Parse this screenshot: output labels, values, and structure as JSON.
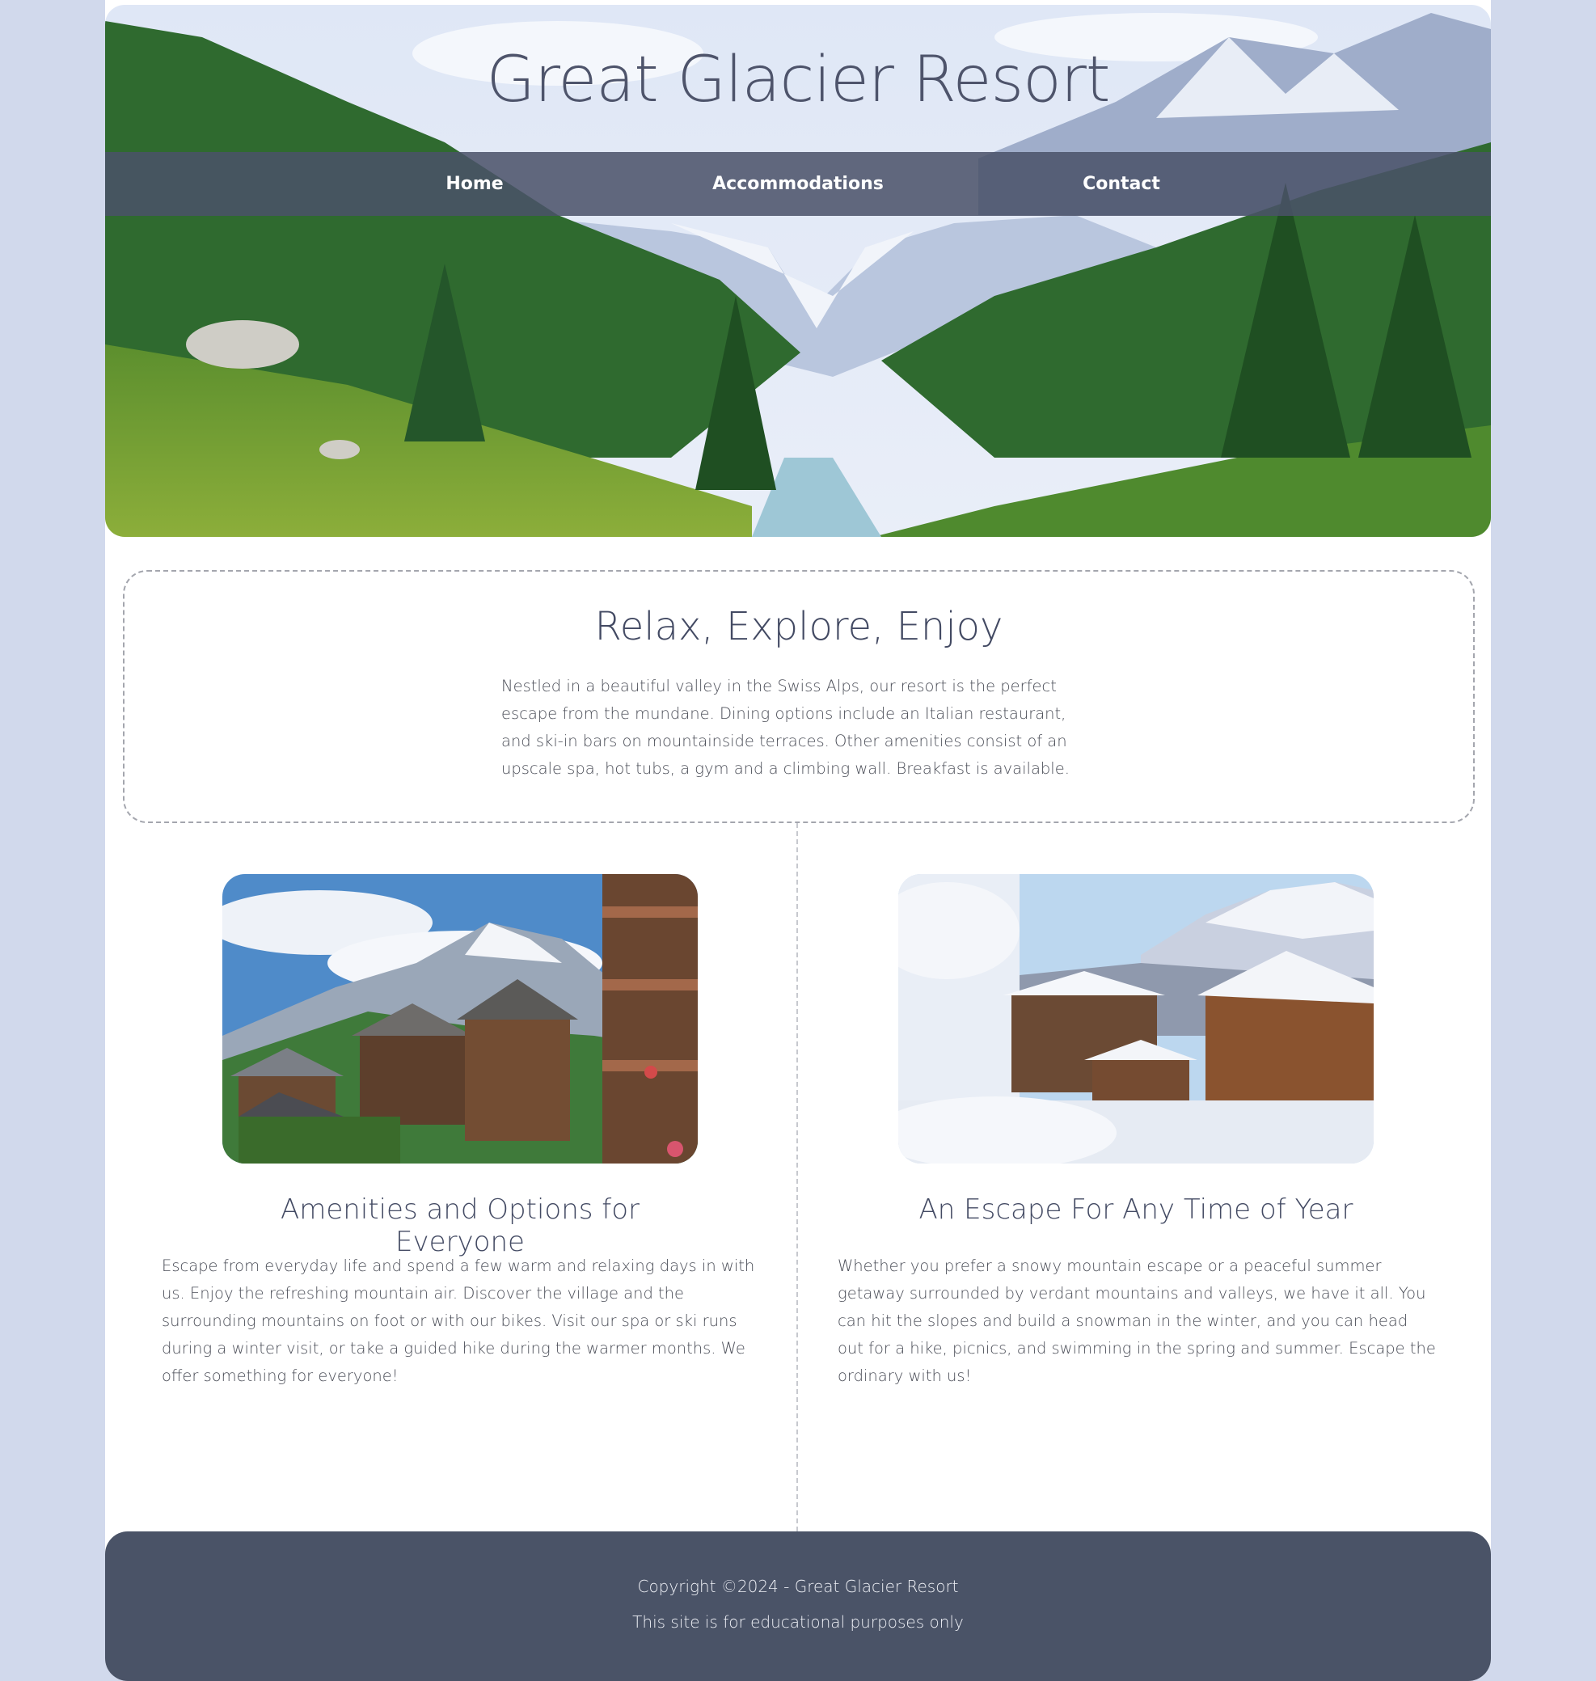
{
  "site": {
    "title": "Great Glacier Resort"
  },
  "nav": {
    "items": [
      {
        "label": "Home"
      },
      {
        "label": "Accommodations"
      },
      {
        "label": "Contact"
      }
    ]
  },
  "intro": {
    "heading": "Relax, Explore, Enjoy",
    "body": "Nestled in a beautiful valley in the Swiss Alps, our resort is the perfect escape from the mundane. Dining options include an Italian restaurant, and ski-in bars on mountainside terraces. Other amenities consist of an upscale spa, hot tubs, a gym and a climbing wall. Breakfast is available."
  },
  "features": [
    {
      "heading": "Amenities and Options for Everyone",
      "body": "Escape from everyday life and spend a few warm and relaxing days in with us. Enjoy the refreshing mountain air. Discover the village and the surrounding mountains on foot or with our bikes. Visit our spa or ski runs during a winter visit, or take a guided hike during the warmer months. We offer something for everyone!"
    },
    {
      "heading": "An Escape For Any Time of Year",
      "body": "Whether you prefer a snowy mountain escape or a peaceful summer getaway surrounded by verdant mountains and valleys, we have it all. You can hit the slopes and build a snowman in the winter, and you can head out for a hike, picnics, and swimming in the spring and summer. Escape the ordinary with us!"
    }
  ],
  "footer": {
    "copyright": "Copyright ©2024 - Great Glacier Resort",
    "note": "This site is for educational purposes only"
  },
  "colors": {
    "page_background": "#d1d9ec",
    "nav_bar": "#4a5269",
    "footer": "#4a5367",
    "heading_text": "#434a63"
  }
}
